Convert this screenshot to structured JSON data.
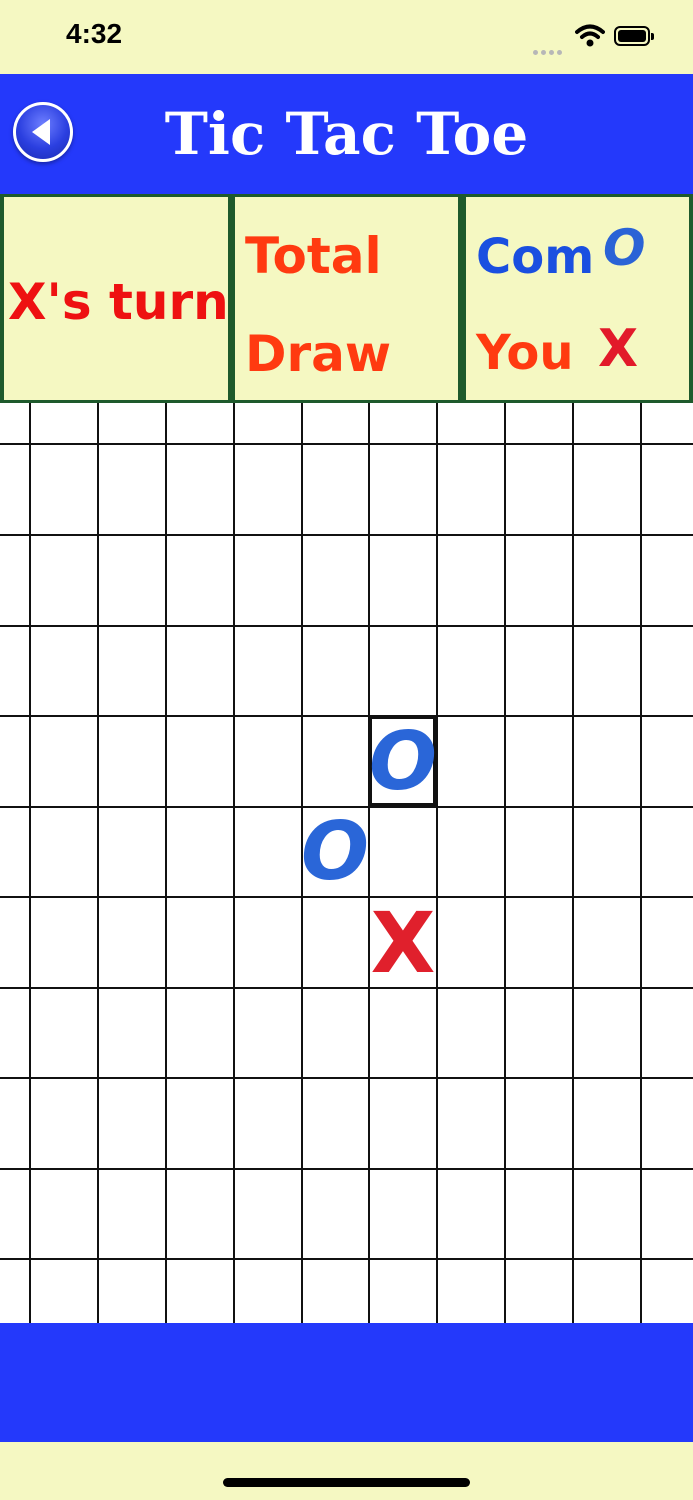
{
  "status": {
    "time": "4:32"
  },
  "header": {
    "title": "Tic Tac Toe",
    "back_icon": "back-arrow-icon"
  },
  "score_panel": {
    "turn": "X's turn",
    "total_label": "Total",
    "draw_label": "Draw",
    "com_label": "Com",
    "com_mark": "O",
    "you_label": "You",
    "you_mark": "X"
  },
  "board": {
    "pieces": [
      "O",
      "O",
      "X"
    ]
  },
  "colors": {
    "background": "#f5f8c2",
    "header_blue": "#2439fb",
    "panel_border": "#1e5a2c",
    "o_blue": "#2a66d8",
    "x_red": "#e0202c",
    "label_orange": "#ff3a10"
  }
}
